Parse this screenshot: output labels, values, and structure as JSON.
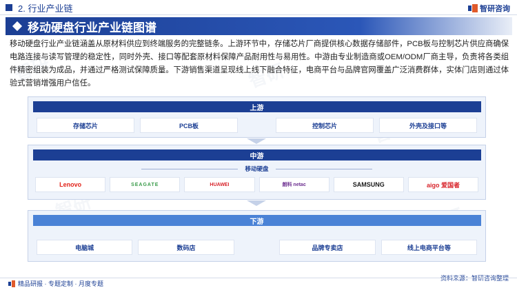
{
  "header": {
    "section_label": "2. 行业产业链",
    "logo_text": "智研咨询"
  },
  "title": "移动硬盘行业产业链图谱",
  "intro": "移动硬盘行业产业链涵盖从原材料供应到终端服务的完整链条。上游环节中，存储芯片厂商提供核心数据存储部件，PCB板与控制芯片供应商确保电路连接与读写管理的稳定性，同时外壳、接口等配套原材料保障产品耐用性与易用性。中游由专业制造商或OEM/ODM厂商主导，负责将各类组件精密组装为成品，并通过严格测试保障质量。下游销售渠道呈现线上线下融合特征，电商平台与品牌官网覆盖广泛消费群体，实体门店则通过体验式营销增强用户信任。",
  "upstream": {
    "title": "上游",
    "items": [
      "存储芯片",
      "PCB板",
      "控制芯片",
      "外壳及接口等"
    ]
  },
  "midstream": {
    "title": "中游",
    "sublabel": "移动硬盘",
    "brands": [
      "Lenovo",
      "SEAGATE",
      "HUAWEI",
      "朗科 netac",
      "SAMSUNG",
      "aigo 爱国者"
    ]
  },
  "downstream": {
    "title": "下游",
    "items": [
      "电脑城",
      "数码店",
      "品牌专卖店",
      "线上电商平台等"
    ]
  },
  "footer": {
    "left": "精品研报 · 专题定制 · 月度专题",
    "right": "资料来源：智研咨询整理"
  },
  "colors": {
    "primary": "#1c3f94",
    "accent": "#4a82d6",
    "panel_bg": "#eef3fb"
  }
}
